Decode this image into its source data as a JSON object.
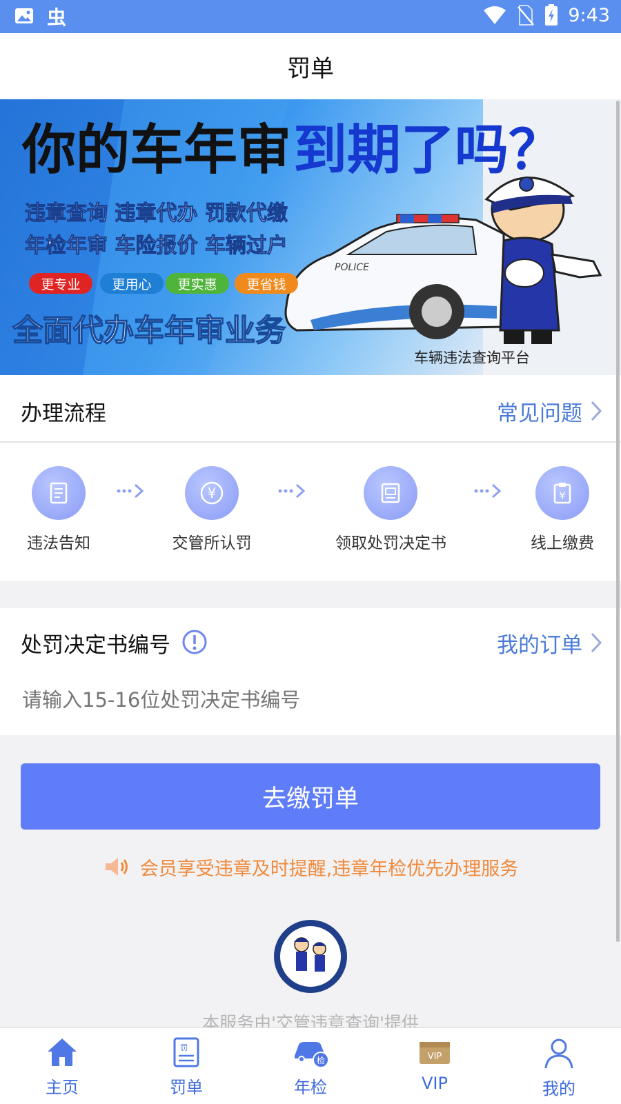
{
  "status_bar": {
    "time": "9:43"
  },
  "header": {
    "title": "罚单"
  },
  "banner": {
    "headline_a": "你的车年审",
    "headline_b": "到期了吗？",
    "services_line1": "违章查询 违章代办 罚款代缴",
    "services_line2": "年检年审 车险报价 车辆过户",
    "tags": [
      "更专业",
      "更用心",
      "更实惠",
      "更省钱"
    ],
    "slogan": "全面代办车年审业务",
    "platform": "车辆违法查询平台",
    "police_text": "POLICE"
  },
  "process": {
    "title": "办理流程",
    "faq_link": "常见问题",
    "steps": [
      {
        "label": "违法告知",
        "icon": "notice-document-icon"
      },
      {
        "label": "交管所认罚",
        "icon": "yen-coin-icon"
      },
      {
        "label": "领取处罚决定书",
        "icon": "decision-document-icon"
      },
      {
        "label": "线上缴费",
        "icon": "clipboard-yen-icon"
      }
    ]
  },
  "ticket": {
    "label": "处罚决定书编号",
    "my_orders": "我的订单",
    "input_placeholder": "请输入15-16位处罚决定书编号"
  },
  "pay_button": "去缴罚单",
  "notice": "会员享受违章及时提醒,违章年检优先办理服务",
  "footer": "本服务由'交管违章查询'提供",
  "tabs": [
    {
      "label": "主页",
      "icon": "home-icon"
    },
    {
      "label": "罚单",
      "icon": "ticket-icon"
    },
    {
      "label": "年检",
      "icon": "car-inspection-icon"
    },
    {
      "label": "VIP",
      "icon": "vip-card-icon"
    },
    {
      "label": "我的",
      "icon": "profile-icon"
    }
  ],
  "colors": {
    "accent": "#5f7df8",
    "status_bar": "#5a8ff0",
    "notice": "#f08a3c",
    "link": "#4a7bd8"
  }
}
